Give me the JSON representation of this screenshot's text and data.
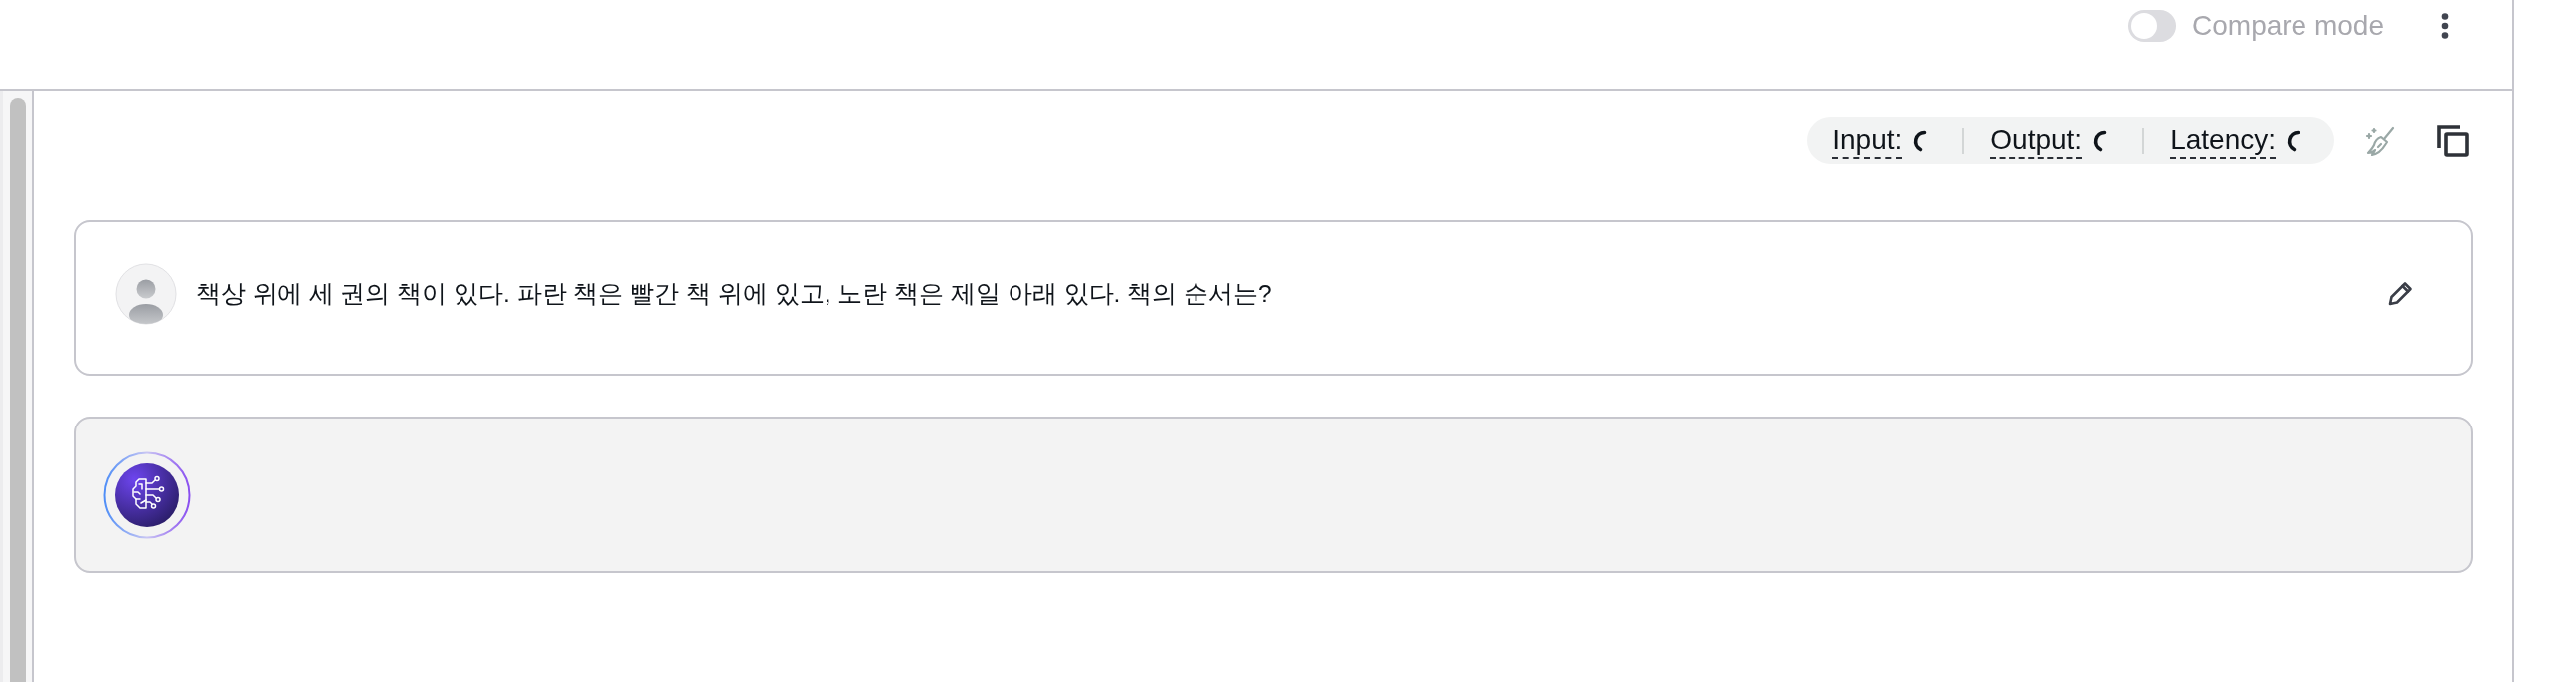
{
  "header": {
    "compare_mode": {
      "label": "Compare mode",
      "on": false,
      "disabled": true
    }
  },
  "metrics": [
    {
      "label": "Input:",
      "loading": true
    },
    {
      "label": "Output:",
      "loading": true
    },
    {
      "label": "Latency:",
      "loading": true
    }
  ],
  "messages": [
    {
      "kind": "user",
      "text": "책상 위에 세 권의 책이 있다. 파란 책은 빨간 책 위에 있고, 노란 책은 제일 아래 있다. 책의 순서는?"
    },
    {
      "kind": "assistant"
    }
  ]
}
